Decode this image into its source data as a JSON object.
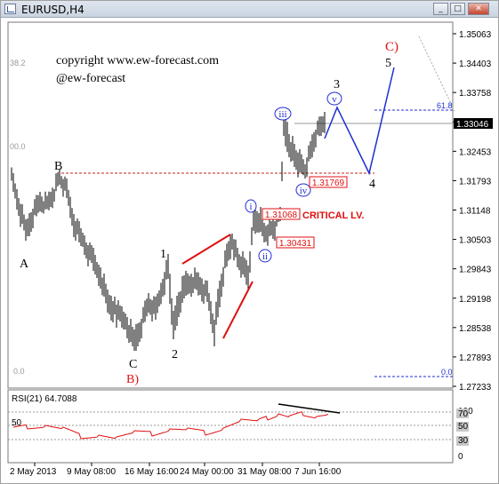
{
  "window": {
    "title": "EURUSD,H4",
    "min_glyph": "_",
    "max_glyph": "□",
    "close_glyph": "✕"
  },
  "watermark": {
    "line1": "copyright www.ew-forecast.com",
    "line2": "@ew-forecast"
  },
  "fib_left": {
    "f382": "38.2",
    "f000": "00.0",
    "f00": "0.0"
  },
  "fib_right": {
    "f618": "61.8",
    "f0": "0.0"
  },
  "price_axis": {
    "ticks": [
      "1.35063",
      "1.34403",
      "1.33758",
      "1.33046",
      "1.32453",
      "1.31793",
      "1.31148",
      "1.30503",
      "1.29843",
      "1.29198",
      "1.28538",
      "1.27893",
      "1.27233"
    ],
    "current_price": "1.33046"
  },
  "wave_labels": {
    "A": "A",
    "B": "B",
    "C": "C",
    "B_major": "B)",
    "C_major": "C)",
    "w1": "1",
    "w2": "2",
    "w3": "3",
    "w4": "4",
    "w5": "5",
    "i": "i",
    "ii": "ii",
    "iii": "iii",
    "iv": "iv",
    "v": "v"
  },
  "levels": {
    "l1": "1.31769",
    "l2": "1.31068",
    "l3": "1.30431",
    "critical": "CRITICAL LV."
  },
  "rsi": {
    "label": "RSI(21) 64.7088",
    "left_level": "50",
    "scale": [
      "100",
      "70",
      "50",
      "30",
      "0"
    ]
  },
  "time_axis": [
    "2 May 2013",
    "9 May 08:00",
    "16 May 16:00",
    "24 May 00:00",
    "31 May 08:00",
    "7 Jun 16:00"
  ],
  "colors": {
    "price_bars": "#000000",
    "projection": "#1f2fd0",
    "trendline": "#e01010",
    "rsi_line": "#e01010",
    "level_box": "#e01010",
    "fib_line": "#1f2fd0",
    "wave_circle": "#1f2fd0"
  }
}
